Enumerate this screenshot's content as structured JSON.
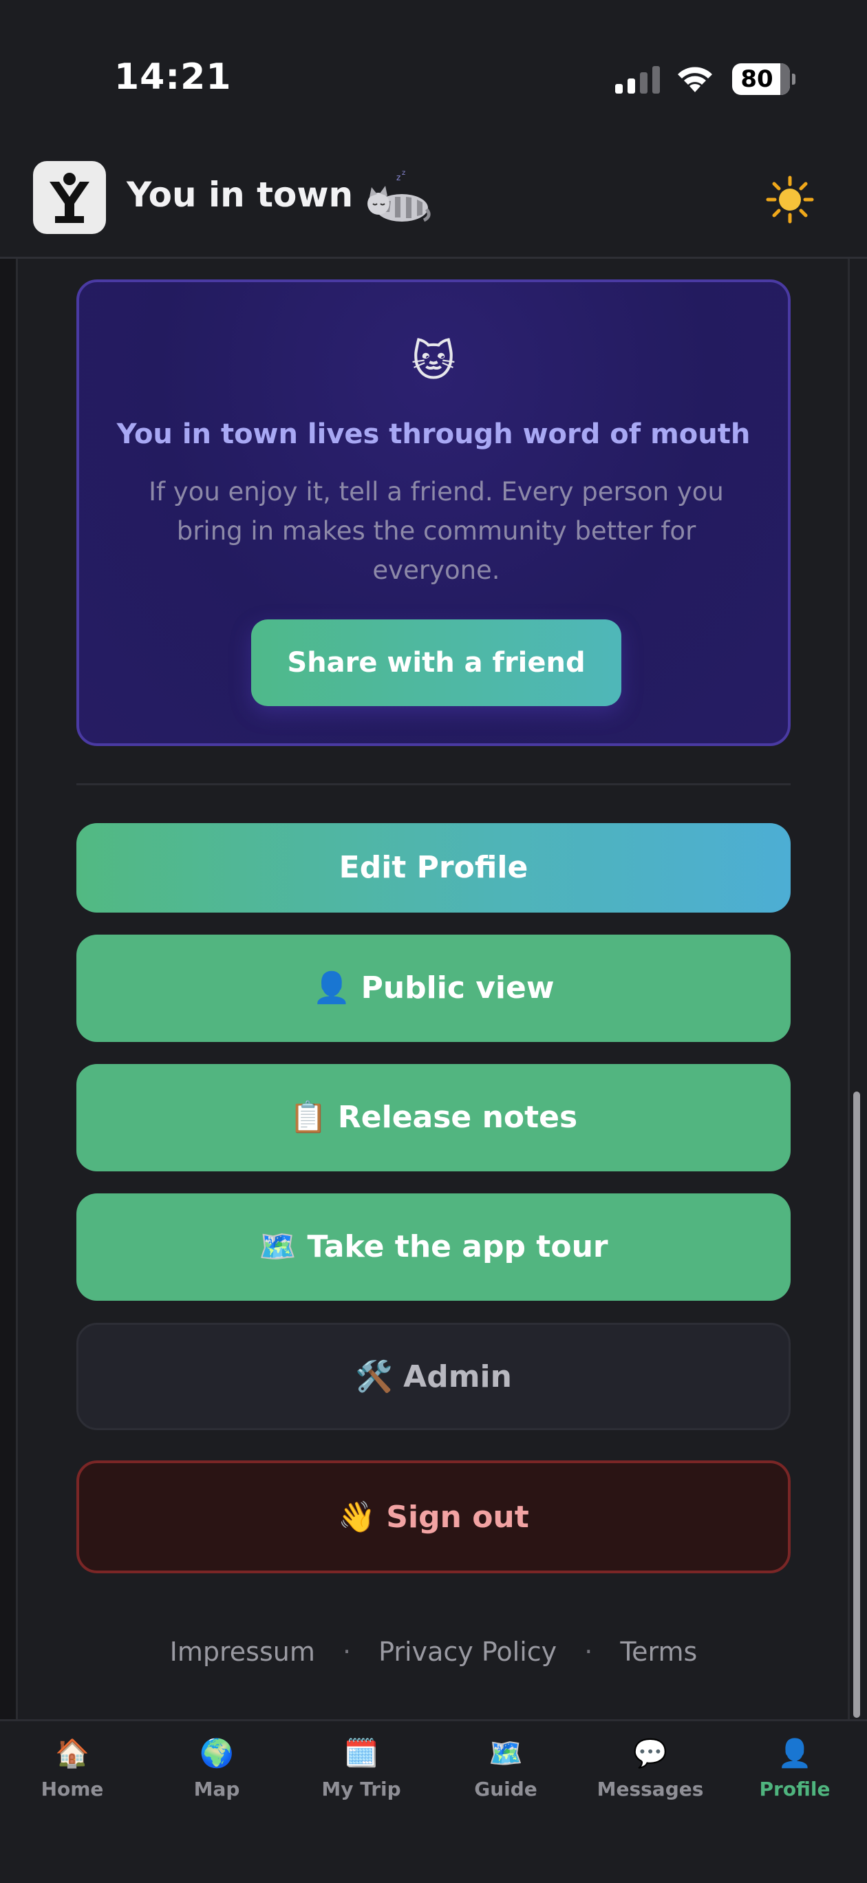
{
  "status_bar": {
    "time": "14:21",
    "battery": "80"
  },
  "header": {
    "title": "You in town",
    "decoration_icon": "sleeping-cat-icon",
    "theme_icon": "sun-icon"
  },
  "share_card": {
    "emoji": "🐱",
    "title": "You in town lives through word of mouth",
    "description": "If you enjoy it, tell a friend. Every person you bring in makes the community better for everyone.",
    "button_label": "Share with a friend"
  },
  "actions": {
    "edit_profile": "Edit Profile",
    "public_view": "👤 Public view",
    "release_notes": "📋 Release notes",
    "app_tour": "🗺️ Take the app tour",
    "admin": "🛠️ Admin",
    "sign_out": "👋 Sign out"
  },
  "footer": {
    "impressum": "Impressum",
    "privacy": "Privacy Policy",
    "terms": "Terms",
    "separator": "·"
  },
  "nav": [
    {
      "label": "Home",
      "icon": "🏠"
    },
    {
      "label": "Map",
      "icon": "🌍"
    },
    {
      "label": "My Trip",
      "icon": "🗓️"
    },
    {
      "label": "Guide",
      "icon": "🗺️"
    },
    {
      "label": "Messages",
      "icon": "💬"
    },
    {
      "label": "Profile",
      "icon": "👤"
    }
  ],
  "colors": {
    "accent": "#4fb47e",
    "card_border": "#4a3aa3",
    "signout_border": "#7a2626"
  }
}
